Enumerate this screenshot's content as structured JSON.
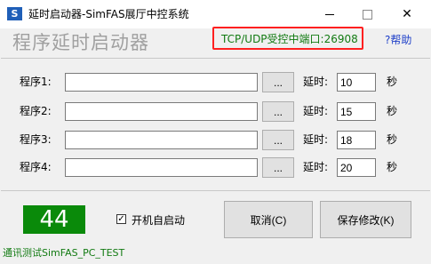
{
  "window": {
    "title": "延时启动器-SimFAS展厅中控系统",
    "icon": "app-logo-icon",
    "icon_glyph": "S",
    "controls": {
      "close_glyph": "✕"
    }
  },
  "header": {
    "big_title": "程序延时启动器",
    "tcp_port": "TCP/UDP受控中端口:26908",
    "help": "?帮助"
  },
  "rows": [
    {
      "label": "程序1:",
      "path": "",
      "browse": "...",
      "delay_label": "延时:",
      "delay": "10",
      "unit": "秒"
    },
    {
      "label": "程序2:",
      "path": "",
      "browse": "...",
      "delay_label": "延时:",
      "delay": "15",
      "unit": "秒"
    },
    {
      "label": "程序3:",
      "path": "",
      "browse": "...",
      "delay_label": "延时:",
      "delay": "18",
      "unit": "秒"
    },
    {
      "label": "程序4:",
      "path": "",
      "browse": "...",
      "delay_label": "延时:",
      "delay": "20",
      "unit": "秒"
    }
  ],
  "footer": {
    "counter": "44",
    "autostart_label": "开机自启动",
    "autostart_checked": true,
    "check_glyph": "✓",
    "cancel": "取消(C)",
    "save": "保存修改(K)",
    "status": "通讯测试SimFAS_PC_TEST"
  },
  "colors": {
    "counter_bg": "#0a8a0a",
    "status_green": "#117a11",
    "highlight_border": "#ff2020",
    "help_link": "#1e3fc8"
  }
}
